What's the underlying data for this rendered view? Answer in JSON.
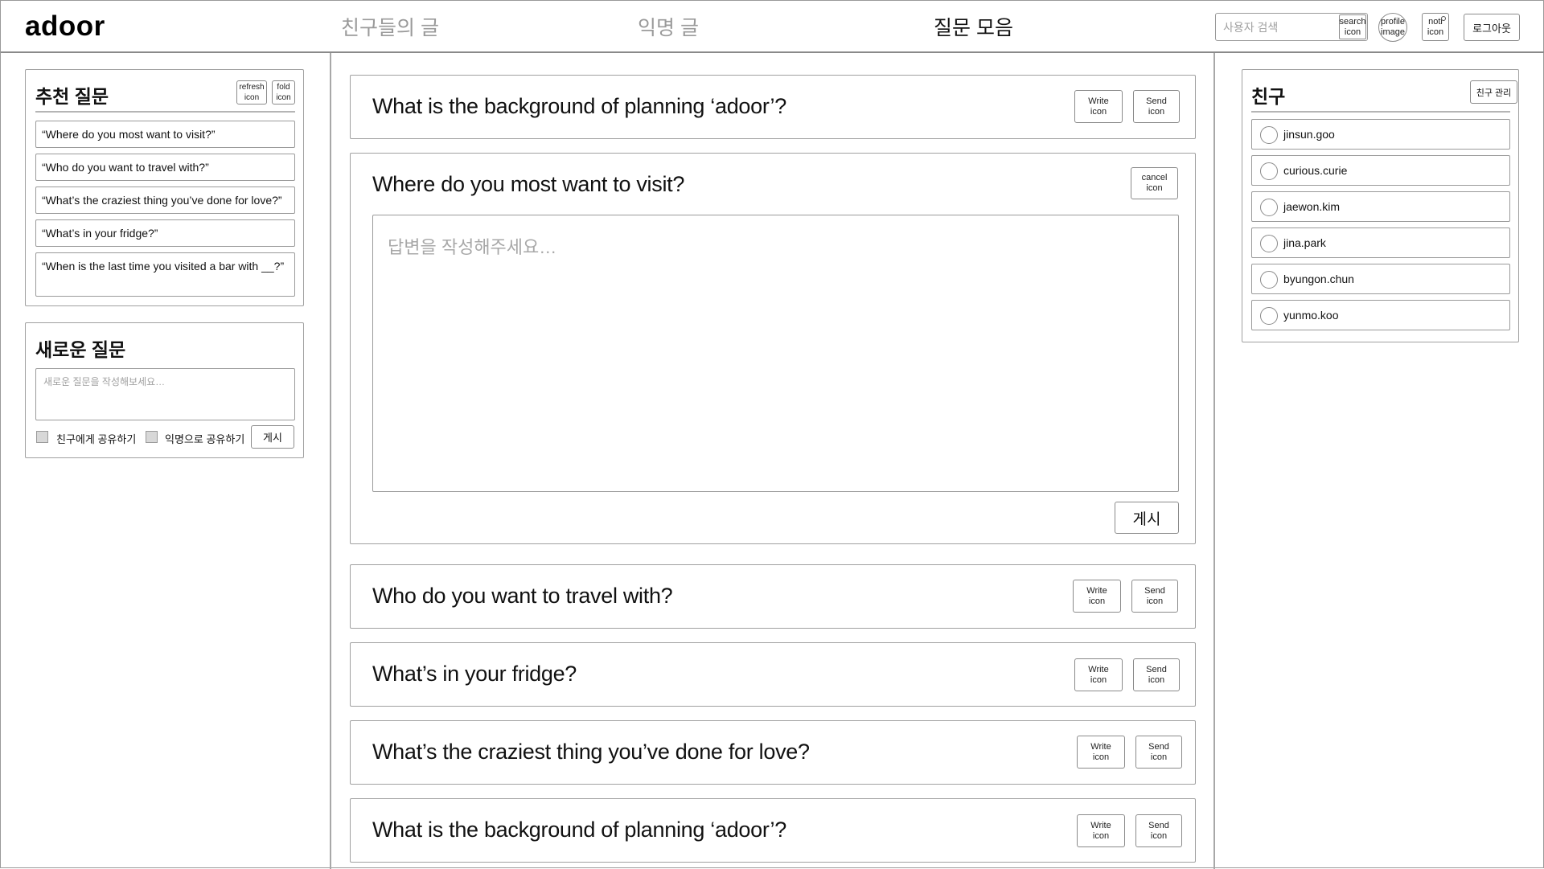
{
  "header": {
    "logo": "adoor",
    "tabs": [
      {
        "label": "친구들의 글",
        "active": false
      },
      {
        "label": "익명 글",
        "active": false
      },
      {
        "label": "질문 모음",
        "active": true
      }
    ],
    "search_placeholder": "사용자 검색",
    "search_icon_label": "search\nicon",
    "profile_image_label": "profile\nimage",
    "noti_icon_label": "noti\nicon",
    "logout_label": "로그아웃"
  },
  "recommended": {
    "title": "추천 질문",
    "refresh_icon_label": "refresh\nicon",
    "fold_icon_label": "fold\nicon",
    "items": [
      "“Where do you most want to visit?”",
      "“Who do you want to travel with?”",
      "“What’s the craziest thing you’ve done for love?”",
      "“What’s in your fridge?”",
      "“When is the last time you visited a bar with __?”"
    ]
  },
  "new_question": {
    "title": "새로운 질문",
    "placeholder": "새로운 질문을 작성해보세요…",
    "share_friends_label": "친구에게 공유하기",
    "share_anon_label": "익명으로 공유하기",
    "post_label": "게시"
  },
  "questions": {
    "write_icon_label": "Write\nicon",
    "send_icon_label": "Send\nicon",
    "cancel_icon_label": "cancel\nicon",
    "answer_placeholder": "답변을 작성해주세요…",
    "post_label": "게시",
    "items": [
      {
        "title": "What is the background of planning ‘adoor’?"
      },
      {
        "title": "Where do you most want to visit?",
        "expanded": true
      },
      {
        "title": "Who do you want to travel with?"
      },
      {
        "title": "What’s in your fridge?"
      },
      {
        "title": "What’s the craziest thing you’ve done for love?"
      },
      {
        "title": "What is the background of planning ‘adoor’?"
      }
    ]
  },
  "friends": {
    "title": "친구",
    "manage_label": "친구 관리",
    "items": [
      "jinsun.goo",
      "curious.curie",
      "jaewon.kim",
      "jina.park",
      "byungon.chun",
      "yunmo.koo"
    ]
  }
}
